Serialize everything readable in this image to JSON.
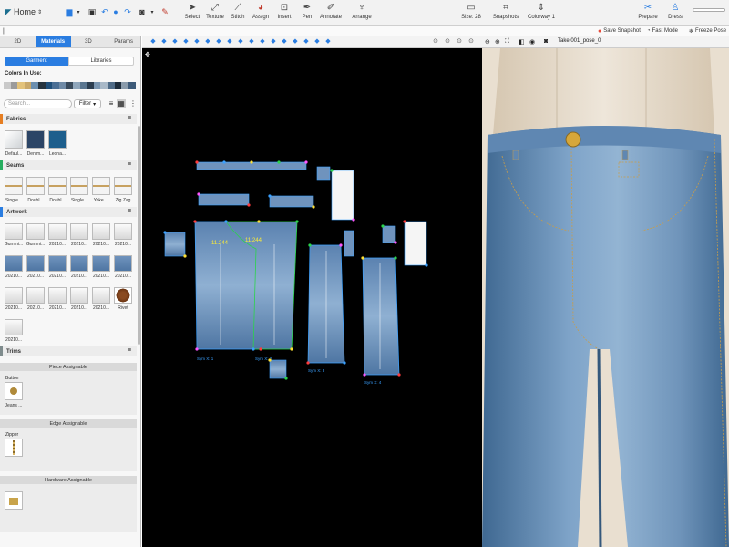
{
  "toolbar": {
    "home_label": "Home",
    "tools": [
      {
        "label": "Select",
        "icon": "cursor-icon"
      },
      {
        "label": "Texture",
        "icon": "texture-icon"
      },
      {
        "label": "Stitch",
        "icon": "stitch-icon"
      },
      {
        "label": "Assign",
        "icon": "assign-icon"
      },
      {
        "label": "Insert",
        "icon": "insert-icon"
      },
      {
        "label": "Pen",
        "icon": "pen-icon"
      },
      {
        "label": "Annotate",
        "icon": "annotate-icon"
      },
      {
        "label": "Arrange",
        "icon": "arrange-icon"
      }
    ],
    "size_label": "Size: 28",
    "snapshots_label": "Snapshots",
    "colorway_label": "Colorway 1",
    "prepare_label": "Prepare",
    "dress_label": "Dress"
  },
  "secondbar": {
    "save_snapshot": "Save Snapshot",
    "fast_mode": "Fast Mode",
    "freeze_pose": "Freeze Pose",
    "take_label": "Take 001_pose_0",
    "accent_color": "#2a7de1"
  },
  "left_panel": {
    "tabs": [
      "2D",
      "Materials",
      "3D",
      "Params"
    ],
    "active_tab": "Materials",
    "segments": [
      "Garment",
      "Libraries"
    ],
    "colors_in_use_label": "Colors In Use:",
    "swatches": [
      "#c9c9c9",
      "#9b9b9b",
      "#e3c27a",
      "#c9a86a",
      "#6b8fb0",
      "#26343f",
      "#1f4f7a",
      "#4b6f95",
      "#6f8aa6",
      "#394a5b",
      "#8fa6bb",
      "#5a7690",
      "#2c3e50",
      "#7b97b2",
      "#a9b9c8",
      "#4e6a86",
      "#1d2c3b",
      "#8a9bab",
      "#3d5a78"
    ],
    "search_placeholder": "Search...",
    "filter_label": "Filter",
    "fabrics_header": "Fabrics",
    "fabrics": [
      "Defaul...",
      "Denim...",
      "Leona..."
    ],
    "seams_header": "Seams",
    "seams": [
      "Single...",
      "Doubl...",
      "Doubl...",
      "Single...",
      "Yoke ...",
      "Zig Zag"
    ],
    "artwork_header": "Artwork",
    "artwork_row1": [
      "Gummi...",
      "Gummi...",
      "20210...",
      "20210...",
      "20210...",
      "20210..."
    ],
    "artwork_row2": [
      "20210...",
      "20210...",
      "20210...",
      "20210...",
      "20210...",
      "20210..."
    ],
    "artwork_row3": [
      "20210...",
      "20210...",
      "20210...",
      "20210...",
      "20210...",
      "Rivet"
    ],
    "artwork_row4": [
      "20210..."
    ],
    "trims_header": "Trims",
    "piece_assignable": "Piece Assignable",
    "button_label": "Button",
    "button_item": "Jeans ...",
    "edge_assignable": "Edge Assignable",
    "zipper_label": "Zipper",
    "third_assignable": "Hardware Assignable"
  },
  "pattern_view": {
    "measure_1": "11.244",
    "measure_2": "11.244",
    "piece_labels": [
      "Sym X: 1",
      "Sym X: 2",
      "Sym X: 3",
      "Sym X: 4"
    ]
  }
}
